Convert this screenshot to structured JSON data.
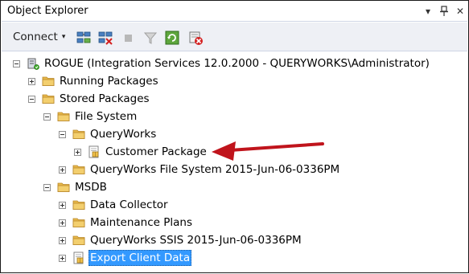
{
  "window": {
    "title": "Object Explorer",
    "buttons": {
      "dropdown": "▾",
      "pin": "📌",
      "close": "✕"
    }
  },
  "toolbar": {
    "connect_label": "Connect",
    "connect_arrow": "▾",
    "icons": [
      "connect-object-explorer-icon",
      "disconnect-icon",
      "stop-icon",
      "filter-icon",
      "refresh-icon",
      "delete-icon"
    ]
  },
  "tree": {
    "nodes": [
      {
        "label": "ROGUE (Integration Services 12.0.2000 - QUERYWORKS\\Administrator)",
        "icon": "server-icon",
        "expander": "minus"
      },
      {
        "label": "Running Packages",
        "icon": "folder-icon",
        "expander": "plus"
      },
      {
        "label": "Stored Packages",
        "icon": "folder-icon",
        "expander": "minus"
      },
      {
        "label": "File System",
        "icon": "folder-icon",
        "expander": "minus"
      },
      {
        "label": "QueryWorks",
        "icon": "folder-icon",
        "expander": "minus"
      },
      {
        "label": "Customer Package",
        "icon": "package-icon",
        "expander": "plus"
      },
      {
        "label": "QueryWorks File System 2015-Jun-06-0336PM",
        "icon": "folder-icon",
        "expander": "plus"
      },
      {
        "label": "MSDB",
        "icon": "folder-icon",
        "expander": "minus"
      },
      {
        "label": "Data Collector",
        "icon": "folder-icon",
        "expander": "plus"
      },
      {
        "label": "Maintenance Plans",
        "icon": "folder-icon",
        "expander": "plus"
      },
      {
        "label": "QueryWorks SSIS 2015-Jun-06-0336PM",
        "icon": "folder-icon",
        "expander": "plus"
      },
      {
        "label": "Export Client Data",
        "icon": "package-icon",
        "expander": "plus",
        "selected": true
      }
    ]
  },
  "colors": {
    "selection": "#3399ff",
    "annotation_arrow": "#c0141c",
    "folder": "#e8b84a",
    "toolbar_bg": "#eef0f5"
  }
}
